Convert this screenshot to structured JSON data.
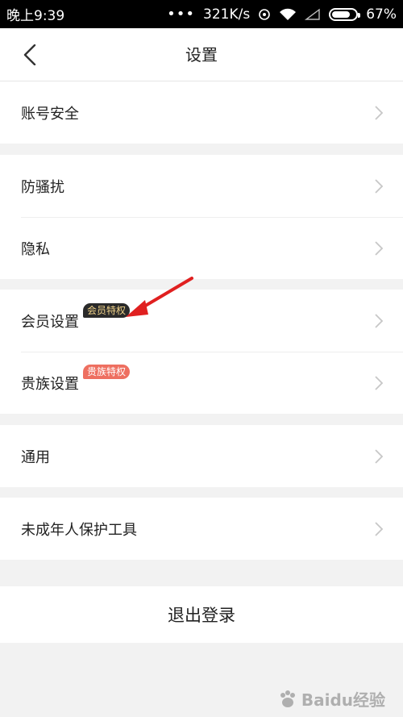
{
  "status_bar": {
    "time": "晚上9:39",
    "dots": "•••",
    "speed": "321K/s",
    "battery": "67%",
    "battery_level": 0.67
  },
  "nav": {
    "title": "设置",
    "back_icon": "chevron-left-icon"
  },
  "groups": [
    {
      "items": [
        {
          "label": "账号安全"
        }
      ]
    },
    {
      "items": [
        {
          "label": "防骚扰"
        },
        {
          "label": "隐私"
        }
      ]
    },
    {
      "items": [
        {
          "label": "会员设置",
          "badge": "会员特权"
        },
        {
          "label": "贵族设置",
          "badge": "贵族特权"
        }
      ]
    },
    {
      "items": [
        {
          "label": "通用"
        }
      ]
    },
    {
      "items": [
        {
          "label": "未成年人保护工具"
        }
      ]
    }
  ],
  "logout_label": "退出登录",
  "watermark": "Baidu经验",
  "colors": {
    "vip_badge_bg": "#2a2a2a",
    "vip_badge_text": "#f2d48a",
    "noble_badge_bg": "#ee6f60",
    "annotation_arrow": "#e02020"
  }
}
